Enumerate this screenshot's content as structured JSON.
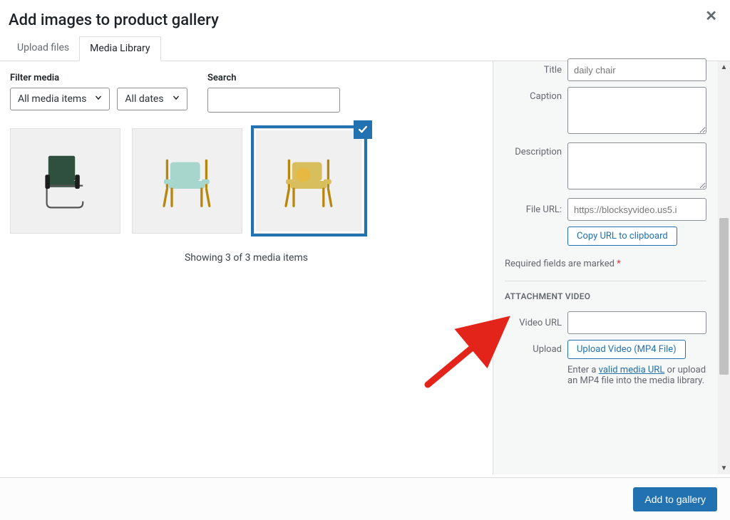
{
  "header": {
    "title": "Add images to product gallery"
  },
  "tabs": {
    "upload": "Upload files",
    "library": "Media Library",
    "active": "library"
  },
  "filters": {
    "label": "Filter media",
    "mediaItems": "All media items",
    "dates": "All dates"
  },
  "search": {
    "label": "Search",
    "value": ""
  },
  "grid": {
    "items": [
      {
        "id": "chair-dark-green",
        "selected": false,
        "accent": "#2f4f3f"
      },
      {
        "id": "chair-light-teal",
        "selected": false,
        "accent": "#a7d6cc"
      },
      {
        "id": "chair-mustard",
        "selected": true,
        "accent": "#d9be5e"
      }
    ],
    "countText": "Showing 3 of 3 media items"
  },
  "details": {
    "titleLabel": "Title",
    "titleValue": "daily chair",
    "captionLabel": "Caption",
    "captionValue": "",
    "descLabel": "Description",
    "descValue": "",
    "urlLabel": "File URL:",
    "urlValue": "https://blocksyvideo.us5.i",
    "copyBtn": "Copy URL to clipboard",
    "requiredNote": "Required fields are marked",
    "requiredMark": "*"
  },
  "attachmentVideo": {
    "heading": "ATTACHMENT VIDEO",
    "videoUrlLabel": "Video URL",
    "videoUrlValue": "",
    "uploadLabel": "Upload",
    "uploadBtn": "Upload Video (MP4 File)",
    "helpPrefix": "Enter a ",
    "helpLink": "valid media URL",
    "helpSuffix": " or upload an MP4 file into the media library."
  },
  "footer": {
    "addBtn": "Add to gallery"
  }
}
